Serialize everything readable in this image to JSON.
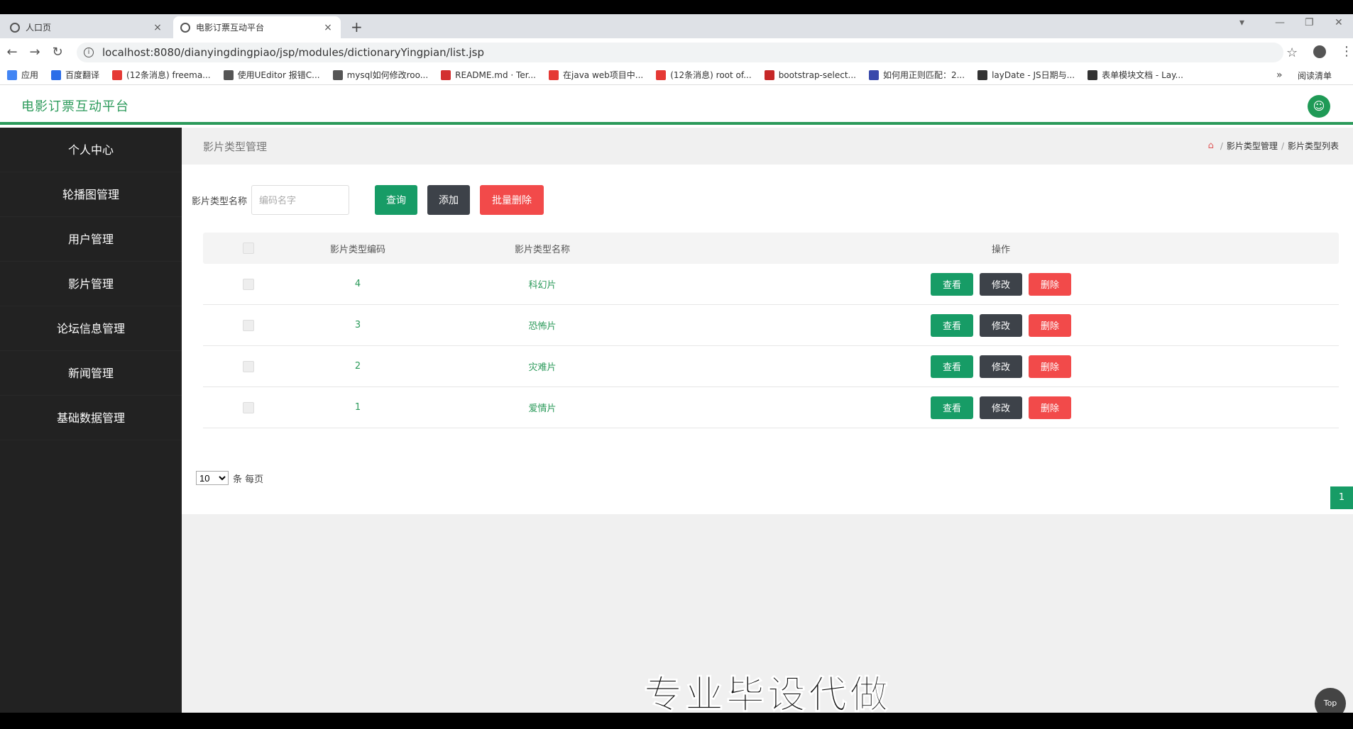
{
  "browser": {
    "tabs": [
      {
        "title": "人口页",
        "close": "×"
      },
      {
        "title": "电影订票互动平台",
        "close": "×"
      }
    ],
    "new_tab": "+",
    "url": "localhost:8080/dianyingdingpiao/jsp/modules/dictionaryYingpian/list.jsp",
    "bookmarks": [
      {
        "label": "应用",
        "color": "#4285f4"
      },
      {
        "label": "百度翻译",
        "color": "#2b6de8"
      },
      {
        "label": "(12条消息) freema...",
        "color": "#e53935"
      },
      {
        "label": "使用UEditor 报错C...",
        "color": "#555555"
      },
      {
        "label": "mysql如何修改roo...",
        "color": "#555555"
      },
      {
        "label": "README.md · Ter...",
        "color": "#d32f2f"
      },
      {
        "label": "在java web项目中...",
        "color": "#e53935"
      },
      {
        "label": "(12条消息) root of...",
        "color": "#e53935"
      },
      {
        "label": "bootstrap-select...",
        "color": "#c62828"
      },
      {
        "label": "如何用正则匹配：2...",
        "color": "#3949ab"
      },
      {
        "label": "layDate - JS日期与...",
        "color": "#333333"
      },
      {
        "label": "表单模块文档 - Lay...",
        "color": "#333333"
      }
    ],
    "bookmarks_more": "»",
    "reading_list": "阅读清单"
  },
  "app": {
    "title": "电影订票互动平台",
    "accent": "#179c66"
  },
  "sidebar": {
    "items": [
      {
        "label": "个人中心"
      },
      {
        "label": "轮播图管理"
      },
      {
        "label": "用户管理"
      },
      {
        "label": "影片管理"
      },
      {
        "label": "论坛信息管理"
      },
      {
        "label": "新闻管理"
      },
      {
        "label": "基础数据管理"
      }
    ]
  },
  "page": {
    "heading": "影片类型管理",
    "breadcrumb": [
      "影片类型管理",
      "影片类型列表"
    ],
    "breadcrumb_sep": "/"
  },
  "search": {
    "label": "影片类型名称",
    "placeholder": "编码名字",
    "query_label": "查询",
    "add_label": "添加",
    "batch_delete_label": "批量删除"
  },
  "table": {
    "columns": [
      "",
      "影片类型编码",
      "影片类型名称",
      "操作"
    ],
    "rows": [
      {
        "code": "4",
        "name": "科幻片"
      },
      {
        "code": "3",
        "name": "恐怖片"
      },
      {
        "code": "2",
        "name": "灾难片"
      },
      {
        "code": "1",
        "name": "爱情片"
      }
    ],
    "row_actions": {
      "view": "查看",
      "edit": "修改",
      "delete": "删除"
    }
  },
  "pagination": {
    "page_size": "10",
    "page_size_suffix": "条 每页",
    "current_page": "1"
  },
  "overlay": {
    "watermark": "专业毕设代做",
    "top_button": "Top"
  }
}
